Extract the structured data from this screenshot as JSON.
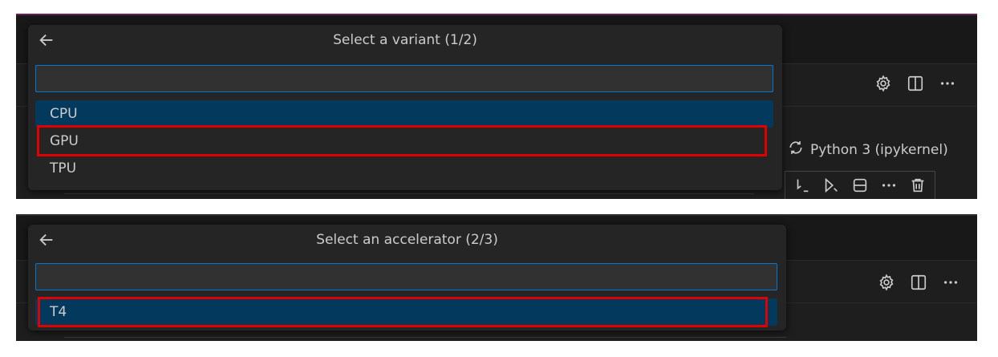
{
  "panel1": {
    "title": "Select a variant (1/2)",
    "input_value": "",
    "items": [
      {
        "label": "CPU",
        "selected": true
      },
      {
        "label": "GPU",
        "selected": false,
        "highlighted": true
      },
      {
        "label": "TPU",
        "selected": false
      }
    ],
    "kernel_label": "Python 3 (ipykernel)",
    "toolbar_icons": [
      "gear-icon",
      "split-editor-icon",
      "more-icon"
    ],
    "cell_toolbar_icons": [
      "execute-above-icon",
      "execute-below-icon",
      "split-cell-icon",
      "more-icon",
      "trash-icon"
    ]
  },
  "panel2": {
    "title": "Select an accelerator (2/3)",
    "input_value": "",
    "items": [
      {
        "label": "T4",
        "selected": true,
        "highlighted": true
      }
    ],
    "toolbar_icons": [
      "gear-icon",
      "split-editor-icon",
      "more-icon"
    ]
  },
  "colors": {
    "background": "#1e1e1e",
    "quickpick": "#252526",
    "selection": "#04395e",
    "focus_border": "#0078d4",
    "highlight": "#e00000"
  }
}
